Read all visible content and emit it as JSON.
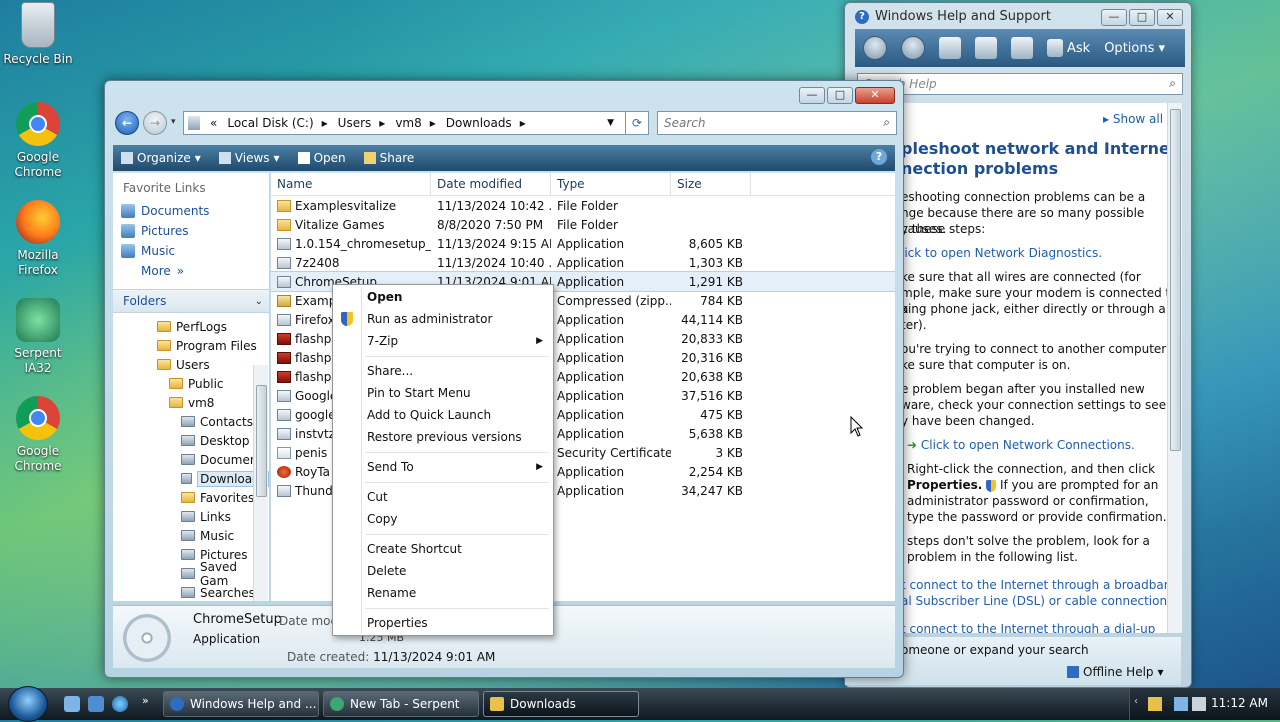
{
  "desktop": {
    "icons": [
      {
        "label": "Recycle Bin"
      },
      {
        "label": "Google Chrome"
      },
      {
        "label": "Mozilla Firefox"
      },
      {
        "label": "Serpent IA32"
      },
      {
        "label": "Google Chrome"
      }
    ]
  },
  "explorer": {
    "window_buttons": {
      "minimize": "—",
      "maximize": "□",
      "close": "✕"
    },
    "address": {
      "prefix": "«",
      "segments": [
        "Local Disk (C:)",
        "Users",
        "vm8",
        "Downloads"
      ],
      "separator": "▸"
    },
    "search_placeholder": "Search",
    "toolbar": {
      "organize": "Organize",
      "views": "Views",
      "open": "Open",
      "share": "Share",
      "help": "?"
    },
    "nav": {
      "favorite_links_header": "Favorite Links",
      "favorites": [
        "Documents",
        "Pictures",
        "Music",
        "More"
      ],
      "more_suffix": "»",
      "folders_header": "Folders",
      "tree": [
        {
          "label": "PerfLogs",
          "level": 0,
          "icon": "folder"
        },
        {
          "label": "Program Files",
          "level": 0,
          "icon": "folder"
        },
        {
          "label": "Users",
          "level": 0,
          "icon": "folder"
        },
        {
          "label": "Public",
          "level": 1,
          "icon": "folder"
        },
        {
          "label": "vm8",
          "level": 1,
          "icon": "folder"
        },
        {
          "label": "Contacts",
          "level": 2,
          "icon": "sys"
        },
        {
          "label": "Desktop",
          "level": 2,
          "icon": "sys"
        },
        {
          "label": "Document",
          "level": 2,
          "icon": "sys"
        },
        {
          "label": "Downloads",
          "level": 2,
          "icon": "sys",
          "selected": true
        },
        {
          "label": "Favorites",
          "level": 2,
          "icon": "folder"
        },
        {
          "label": "Links",
          "level": 2,
          "icon": "sys"
        },
        {
          "label": "Music",
          "level": 2,
          "icon": "sys"
        },
        {
          "label": "Pictures",
          "level": 2,
          "icon": "sys"
        },
        {
          "label": "Saved Gam",
          "level": 2,
          "icon": "sys"
        },
        {
          "label": "Searches",
          "level": 2,
          "icon": "sys"
        }
      ]
    },
    "columns": [
      "Name",
      "Date modified",
      "Type",
      "Size"
    ],
    "files": [
      {
        "name": "Examplesvitalize",
        "date": "11/13/2024 10:42 ...",
        "type": "File Folder",
        "size": "",
        "icon": "folder"
      },
      {
        "name": "Vitalize Games",
        "date": "8/8/2020 7:50 PM",
        "type": "File Folder",
        "size": "",
        "icon": "folder"
      },
      {
        "name": "1.0.154_chromesetup_...",
        "date": "11/13/2024 9:15 AM",
        "type": "Application",
        "size": "8,605 KB",
        "icon": "app"
      },
      {
        "name": "7z2408",
        "date": "11/13/2024 10:40 ...",
        "type": "Application",
        "size": "1,303 KB",
        "icon": "app"
      },
      {
        "name": "ChromeSetup",
        "date": "11/13/2024 9:01 AM",
        "type": "Application",
        "size": "1,291 KB",
        "icon": "app",
        "selected": true
      },
      {
        "name": "Examp",
        "date": "",
        "type": "Compressed (zipp...",
        "size": "784 KB",
        "icon": "zip"
      },
      {
        "name": "Firefox",
        "date": "",
        "type": "Application",
        "size": "44,114 KB",
        "icon": "app"
      },
      {
        "name": "flashpl",
        "date": "",
        "type": "Application",
        "size": "20,833 KB",
        "icon": "flash"
      },
      {
        "name": "flashpl",
        "date": "",
        "type": "Application",
        "size": "20,316 KB",
        "icon": "flash"
      },
      {
        "name": "flashpl",
        "date": "",
        "type": "Application",
        "size": "20,638 KB",
        "icon": "flash"
      },
      {
        "name": "Google",
        "date": "",
        "type": "Application",
        "size": "37,516 KB",
        "icon": "app"
      },
      {
        "name": "google",
        "date": "",
        "type": "Application",
        "size": "475 KB",
        "icon": "app"
      },
      {
        "name": "instvtz",
        "date": "",
        "type": "Application",
        "size": "5,638 KB",
        "icon": "app"
      },
      {
        "name": "penis",
        "date": "",
        "type": "Security Certificate",
        "size": "3 KB",
        "icon": "cert"
      },
      {
        "name": "RoyTa",
        "date": "",
        "type": "Application",
        "size": "2,254 KB",
        "icon": "red"
      },
      {
        "name": "Thund",
        "date": "",
        "type": "Application",
        "size": "34,247 KB",
        "icon": "app"
      }
    ],
    "details": {
      "name": "ChromeSetup",
      "type": "Application",
      "date_modified_label": "Date modi",
      "size_value": "1.25 MB",
      "date_created_label": "Date created:",
      "date_created_value": "11/13/2024 9:01 AM"
    }
  },
  "context_menu": {
    "items": [
      {
        "label": "Open",
        "bold": true
      },
      {
        "label": "Run as administrator",
        "icon": "shield-icon"
      },
      {
        "label": "7-Zip",
        "submenu": true
      },
      {
        "sep": true
      },
      {
        "label": "Share..."
      },
      {
        "label": "Pin to Start Menu"
      },
      {
        "label": "Add to Quick Launch"
      },
      {
        "label": "Restore previous versions"
      },
      {
        "sep": true
      },
      {
        "label": "Send To",
        "submenu": true
      },
      {
        "sep": true
      },
      {
        "label": "Cut"
      },
      {
        "label": "Copy"
      },
      {
        "sep": true
      },
      {
        "label": "Create Shortcut"
      },
      {
        "label": "Delete"
      },
      {
        "label": "Rename"
      },
      {
        "sep": true
      },
      {
        "label": "Properties"
      }
    ]
  },
  "help_window": {
    "title": "Windows Help and Support",
    "toolbar": {
      "ask": "Ask",
      "options": "Options"
    },
    "search_placeholder": "Search Help",
    "show_all": "Show all",
    "heading_line1": "pleshoot network and Internet",
    "heading_line2": "nection problems",
    "lines": [
      "eshooting connection problems can be a",
      "nge because there are so many possible causes.",
      "y these steps:",
      "lick to open Network Diagnostics.",
      "ke sure that all wires are connected (for",
      "mple, make sure your modem is connected to a",
      "king phone jack, either directly or through a",
      "ter).",
      "ou're trying to connect to another computer,",
      "ke sure that computer is on.",
      "e problem began after you installed new",
      "ware, check your connection settings to see if",
      "y have been changed.",
      "Click to open Network Connections.",
      "Right-click the connection, and then click",
      "Properties.",
      "If you are prompted for an",
      "administrator password or confirmation,",
      "type the password or provide confirmation.",
      "steps don't solve the problem, look for a",
      "problem in the following list.",
      "t connect to the Internet through a broadband",
      "al Subscriber Line (DSL) or cable connection.",
      "t connect to the Internet through a dial-up"
    ],
    "footer_text": "omeone or expand your search",
    "offline_help": "Offline Help"
  },
  "taskbar": {
    "tasks": [
      {
        "label": "Windows Help and ...",
        "active": false
      },
      {
        "label": "New Tab - Serpent",
        "active": false
      },
      {
        "label": "Downloads",
        "active": true
      }
    ],
    "clock": "11:12 AM"
  }
}
